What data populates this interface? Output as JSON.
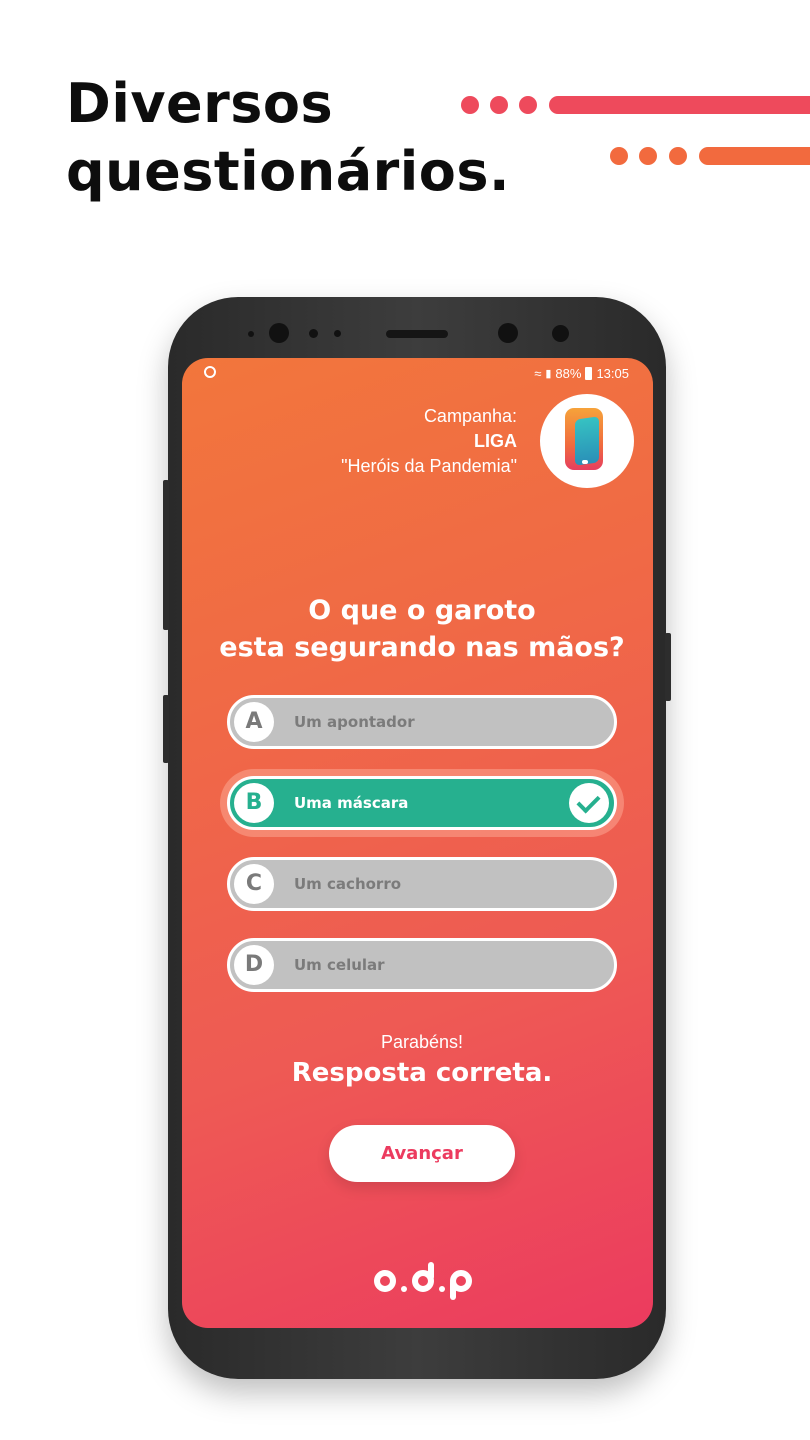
{
  "headline": {
    "line1": "Diversos",
    "line2": "questionários."
  },
  "colors": {
    "accent_red": "#ec3b5f",
    "accent_orange": "#f2763c",
    "correct_green": "#26b08f",
    "option_gray": "#c1c1c1"
  },
  "status_bar": {
    "battery": "88%",
    "time": "13:05",
    "icons": [
      "app-notification-icon",
      "wifi-icon",
      "signal-icon",
      "battery-icon"
    ]
  },
  "campaign": {
    "label": "Campanha:",
    "name": "LIGA",
    "subtitle": "\"Heróis da Pandemia\""
  },
  "question": {
    "line1": "O que o garoto",
    "line2": "esta segurando nas mãos?"
  },
  "options": [
    {
      "letter": "A",
      "text": "Um apontador",
      "state": "default"
    },
    {
      "letter": "B",
      "text": "Uma máscara",
      "state": "correct"
    },
    {
      "letter": "C",
      "text": "Um cachorro",
      "state": "default"
    },
    {
      "letter": "D",
      "text": "Um celular",
      "state": "default"
    }
  ],
  "feedback": {
    "congrats": "Parabéns!",
    "result": "Resposta correta."
  },
  "advance_button": {
    "label": "Avançar"
  },
  "brand": {
    "logo": "odp-logo"
  }
}
